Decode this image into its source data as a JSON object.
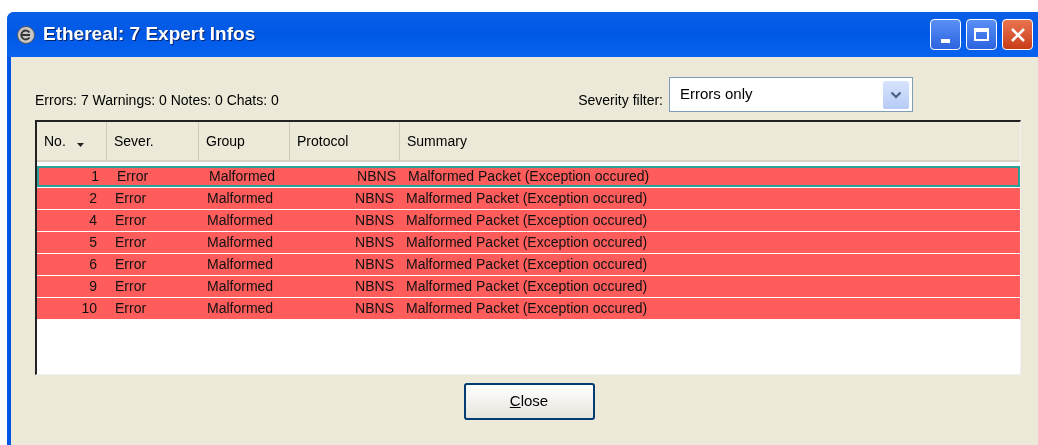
{
  "window": {
    "title": "Ethereal: 7 Expert Infos"
  },
  "counts": "Errors: 7 Warnings: 0 Notes: 0 Chats: 0",
  "severity_filter": {
    "label": "Severity filter:",
    "value": "Errors only"
  },
  "table": {
    "columns": [
      {
        "label": "No.",
        "sorted": true
      },
      {
        "label": "Sever.",
        "sorted": false
      },
      {
        "label": "Group",
        "sorted": false
      },
      {
        "label": "Protocol",
        "sorted": false
      },
      {
        "label": "Summary",
        "sorted": false
      }
    ],
    "rows": [
      {
        "cells": [
          "1",
          "Error",
          "Malformed",
          "NBNS",
          "Malformed Packet (Exception occured)"
        ],
        "selected": true,
        "color": "#ff5c5c"
      },
      {
        "cells": [
          "2",
          "Error",
          "Malformed",
          "NBNS",
          "Malformed Packet (Exception occured)"
        ],
        "selected": false,
        "color": "#ff5c5c"
      },
      {
        "cells": [
          "4",
          "Error",
          "Malformed",
          "NBNS",
          "Malformed Packet (Exception occured)"
        ],
        "selected": false,
        "color": "#ff5c5c"
      },
      {
        "cells": [
          "5",
          "Error",
          "Malformed",
          "NBNS",
          "Malformed Packet (Exception occured)"
        ],
        "selected": false,
        "color": "#ff5c5c"
      },
      {
        "cells": [
          "6",
          "Error",
          "Malformed",
          "NBNS",
          "Malformed Packet (Exception occured)"
        ],
        "selected": false,
        "color": "#ff5c5c"
      },
      {
        "cells": [
          "9",
          "Error",
          "Malformed",
          "NBNS",
          "Malformed Packet (Exception occured)"
        ],
        "selected": false,
        "color": "#ff5c5c"
      },
      {
        "cells": [
          "10",
          "Error",
          "Malformed",
          "NBNS",
          "Malformed Packet (Exception occured)"
        ],
        "selected": false,
        "color": "#ff5c5c"
      }
    ]
  },
  "buttons": [
    {
      "label": "Close",
      "mnemonic_underlined": true
    }
  ]
}
